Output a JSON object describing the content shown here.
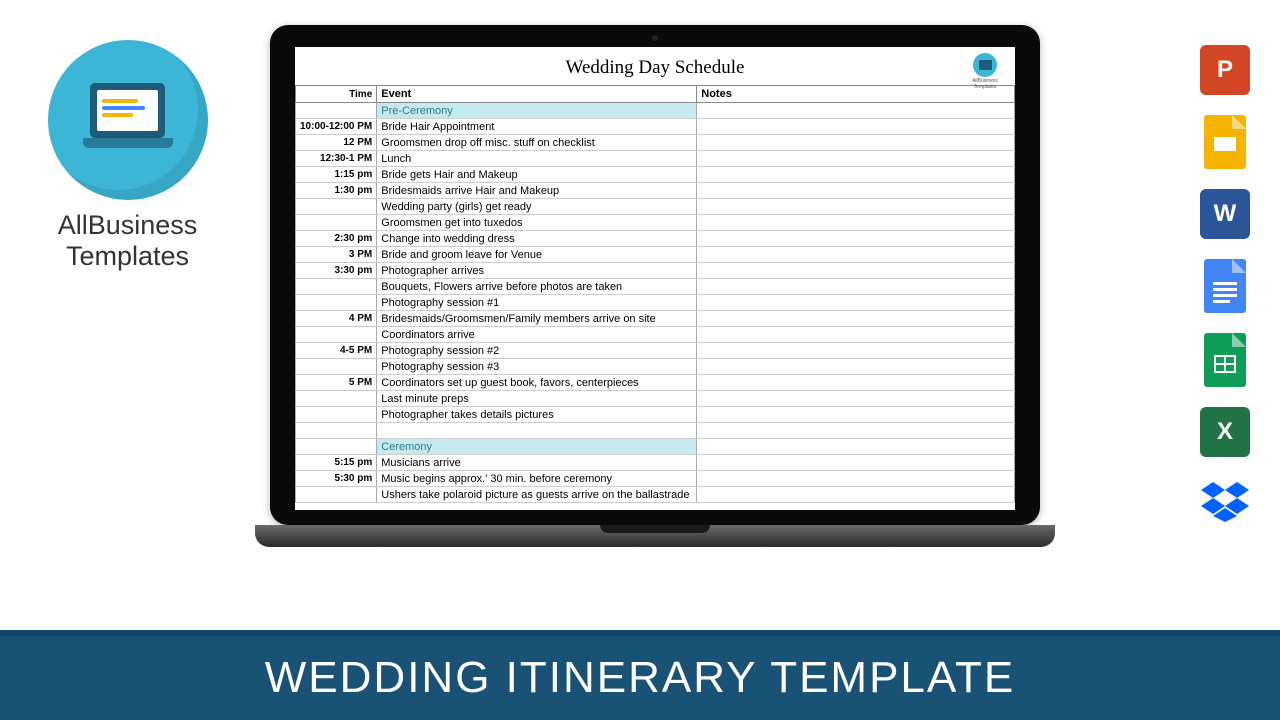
{
  "logo": {
    "brand_line1": "AllBusiness",
    "brand_line2": "Templates"
  },
  "document": {
    "title": "Wedding Day Schedule",
    "watermark": "AllBusiness Templates",
    "columns": {
      "time": "Time",
      "event": "Event",
      "notes": "Notes"
    },
    "rows": [
      {
        "time": "",
        "event": "Pre-Ceremony",
        "notes": "",
        "section": true
      },
      {
        "time": "10:00-12:00 PM",
        "event": "Bride Hair Appointment",
        "notes": ""
      },
      {
        "time": "12 PM",
        "event": "Groomsmen drop off misc. stuff on checklist",
        "notes": ""
      },
      {
        "time": "12:30-1 PM",
        "event": "Lunch",
        "notes": ""
      },
      {
        "time": "1:15 pm",
        "event": "Bride gets Hair and Makeup",
        "notes": ""
      },
      {
        "time": "1:30 pm",
        "event": "Bridesmaids arrive Hair and Makeup",
        "notes": ""
      },
      {
        "time": "",
        "event": "Wedding party (girls) get ready",
        "notes": ""
      },
      {
        "time": "",
        "event": "Groomsmen get into tuxedos",
        "notes": ""
      },
      {
        "time": "2:30 pm",
        "event": "Change into wedding dress",
        "notes": ""
      },
      {
        "time": "3 PM",
        "event": "Bride and groom leave for Venue",
        "notes": ""
      },
      {
        "time": "3:30 pm",
        "event": "Photographer arrives",
        "notes": ""
      },
      {
        "time": "",
        "event": "Bouquets, Flowers arrive before photos are taken",
        "notes": ""
      },
      {
        "time": "",
        "event": "Photography session #1",
        "notes": ""
      },
      {
        "time": "4 PM",
        "event": "Bridesmaids/Groomsmen/Family members arrive on site",
        "notes": ""
      },
      {
        "time": "",
        "event": "Coordinators arrive",
        "notes": ""
      },
      {
        "time": "4-5 PM",
        "event": "Photography session #2",
        "notes": ""
      },
      {
        "time": "",
        "event": "Photography session #3",
        "notes": ""
      },
      {
        "time": "5 PM",
        "event": "Coordinators set up guest book, favors, centerpieces",
        "notes": ""
      },
      {
        "time": "",
        "event": "Last minute preps",
        "notes": ""
      },
      {
        "time": "",
        "event": "Photographer takes details pictures",
        "notes": ""
      },
      {
        "time": "",
        "event": "",
        "notes": ""
      },
      {
        "time": "",
        "event": "Ceremony",
        "notes": "",
        "section": true
      },
      {
        "time": "5:15 pm",
        "event": "Musicians arrive",
        "notes": ""
      },
      {
        "time": "5:30 pm",
        "event": "Music begins approx.' 30 min. before ceremony",
        "notes": ""
      },
      {
        "time": "",
        "event": "Ushers take polaroid picture as guests arrive on the ballastrade",
        "notes": ""
      }
    ]
  },
  "file_icons": {
    "ppt": "P",
    "slides": "",
    "word": "W",
    "docs": "",
    "sheets": "",
    "excel": "X",
    "dropbox": ""
  },
  "banner": {
    "title": "WEDDING ITINERARY TEMPLATE"
  }
}
